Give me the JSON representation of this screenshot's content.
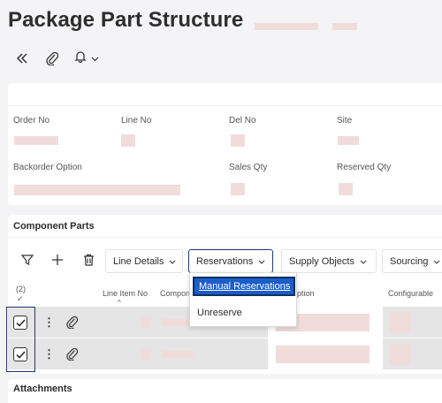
{
  "page": {
    "title": "Package Part Structure"
  },
  "toolbar_top": {
    "collapse_icon": "double-chevron-left-icon",
    "attach_icon": "paperclip-icon",
    "notify_icon": "bell-icon"
  },
  "header": {
    "fields": [
      {
        "label": "Order No"
      },
      {
        "label": "Line No"
      },
      {
        "label": "Del No"
      },
      {
        "label": "Site"
      },
      {
        "label": "Backorder Option"
      },
      {
        "label": "Sales Qty"
      },
      {
        "label": "Reserved Qty"
      }
    ]
  },
  "component_parts": {
    "title": "Component Parts",
    "toolbar": {
      "line_details": "Line Details",
      "reservations": "Reservations",
      "supply_objects": "Supply Objects",
      "sourcing": "Sourcing"
    },
    "selected_count": "(2)",
    "check_all": "✓",
    "columns": {
      "line_item_no": "Line Item No",
      "component": "Compon",
      "description": "ption",
      "configurable": "Configurable"
    },
    "rows": [
      {
        "checked": true
      },
      {
        "checked": true
      }
    ]
  },
  "reservations_menu": {
    "items": [
      "Manual Reservations",
      "Unreserve"
    ]
  },
  "attachments": {
    "title": "Attachments"
  },
  "colors": {
    "accent": "#1b5dc9",
    "frame": "#1e3a6e",
    "placeholder": "#f1dcdc"
  }
}
